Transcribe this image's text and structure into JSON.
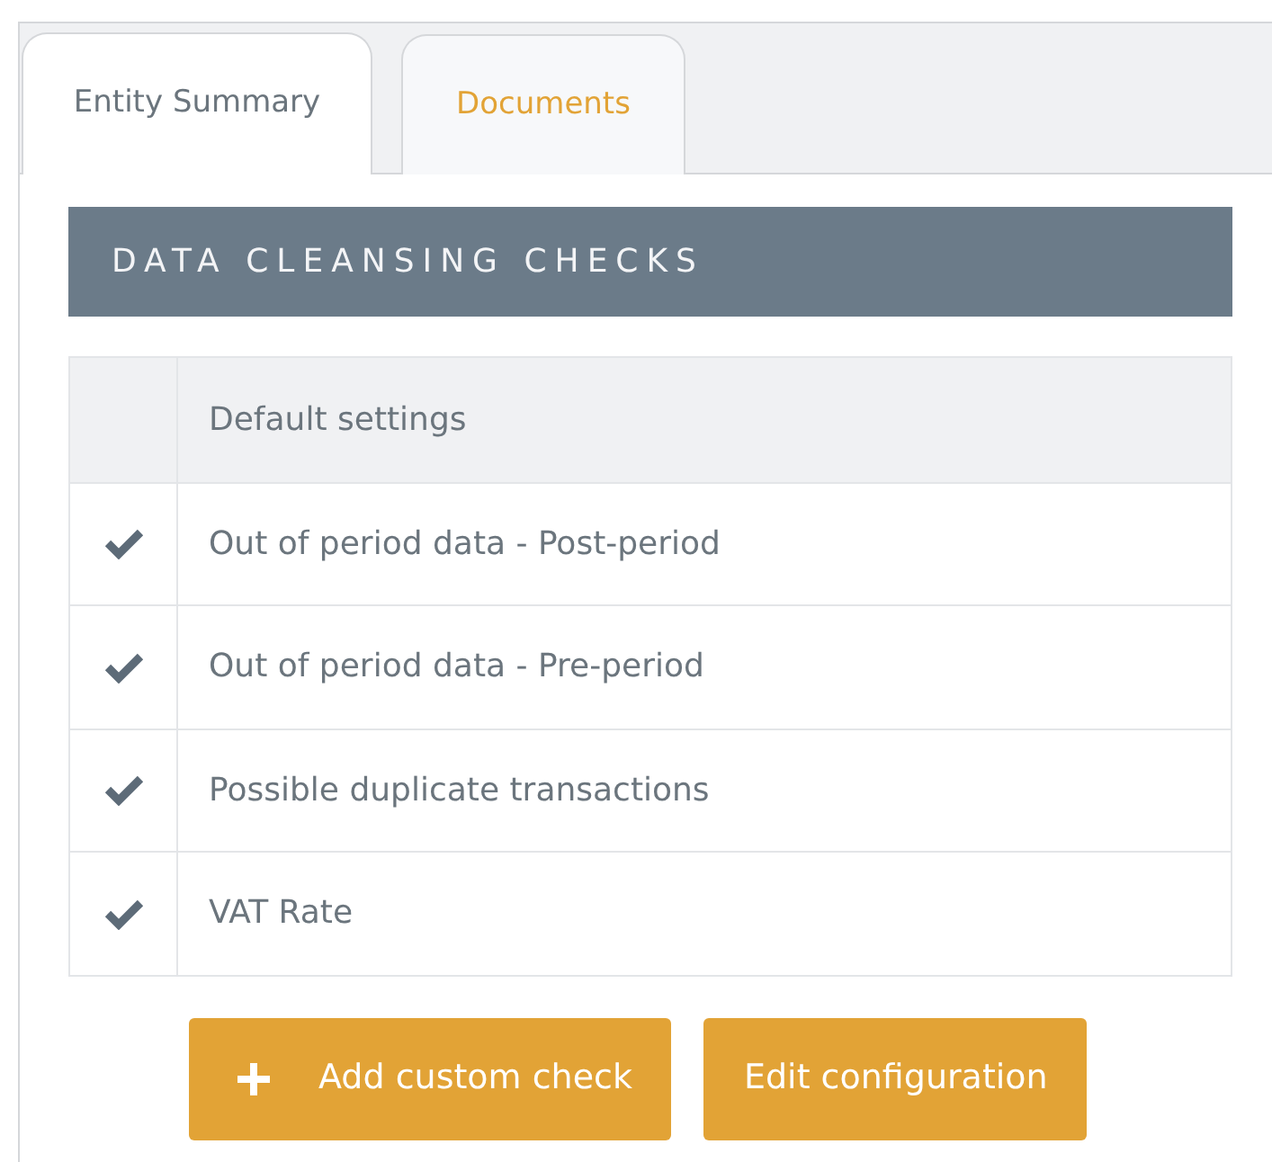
{
  "tabs": [
    {
      "label": "Entity Summary",
      "selected": true
    },
    {
      "label": "Documents",
      "selected": false
    }
  ],
  "section_title": "DATA CLEANSING CHECKS",
  "table": {
    "header": "Default settings",
    "rows": [
      {
        "label": "Out of period data - Post-period",
        "checked": true
      },
      {
        "label": "Out of period data - Pre-period",
        "checked": true
      },
      {
        "label": "Possible duplicate transactions",
        "checked": true
      },
      {
        "label": "VAT Rate",
        "checked": true
      }
    ]
  },
  "buttons": [
    {
      "kind": "add",
      "label": "Add custom check"
    },
    {
      "kind": "plain",
      "label": "Edit configuration"
    }
  ]
}
